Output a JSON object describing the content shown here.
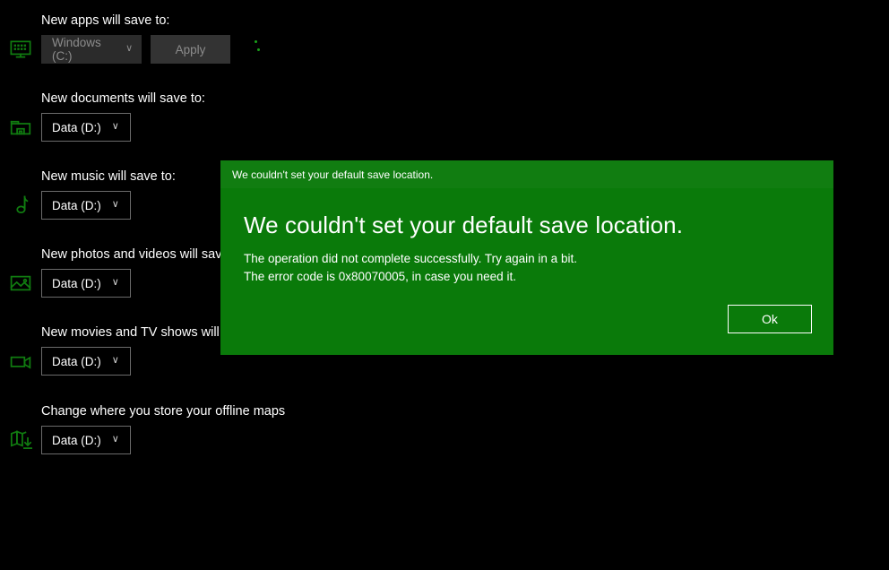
{
  "settings": {
    "groups": [
      {
        "label": "New apps will save to:",
        "icon": "apps-monitor-icon",
        "value": "Windows (C:)",
        "chevron": "∨",
        "disabled": true,
        "apply_label": "Apply",
        "has_apply": true,
        "has_spinner": true
      },
      {
        "label": "New documents will save to:",
        "icon": "documents-folder-icon",
        "value": "Data (D:)",
        "chevron": "∨",
        "disabled": false,
        "has_apply": false,
        "has_spinner": false
      },
      {
        "label": "New music will save to:",
        "icon": "music-note-icon",
        "value": "Data (D:)",
        "chevron": "∨",
        "disabled": false,
        "has_apply": false,
        "has_spinner": false
      },
      {
        "label": "New photos and videos will save to:",
        "icon": "photos-image-icon",
        "value": "Data (D:)",
        "chevron": "∨",
        "disabled": false,
        "has_apply": false,
        "has_spinner": false
      },
      {
        "label": "New movies and TV shows will save to:",
        "icon": "movies-camera-icon",
        "value": "Data (D:)",
        "chevron": "∨",
        "disabled": false,
        "has_apply": false,
        "has_spinner": false
      },
      {
        "label": "Change where you store your offline maps",
        "icon": "offline-maps-download-icon",
        "value": "Data (D:)",
        "chevron": "∨",
        "disabled": false,
        "has_apply": false,
        "has_spinner": false
      }
    ]
  },
  "dialog": {
    "titlebar_text": "We couldn't set your default save location.",
    "heading": "We couldn't set your default save location.",
    "body_line1": "The operation did not complete successfully. Try again in a bit.",
    "body_line2": "The error code is 0x80070005, in case you need it.",
    "ok_label": "Ok"
  },
  "colors": {
    "page_background": "#000000",
    "dialog_body_green": "#0a7a0a",
    "dialog_titlebar_green": "#117d11",
    "icon_green": "#107c10",
    "disabled_text": "#8c8c8c",
    "combo_border": "#6b6b6b"
  }
}
